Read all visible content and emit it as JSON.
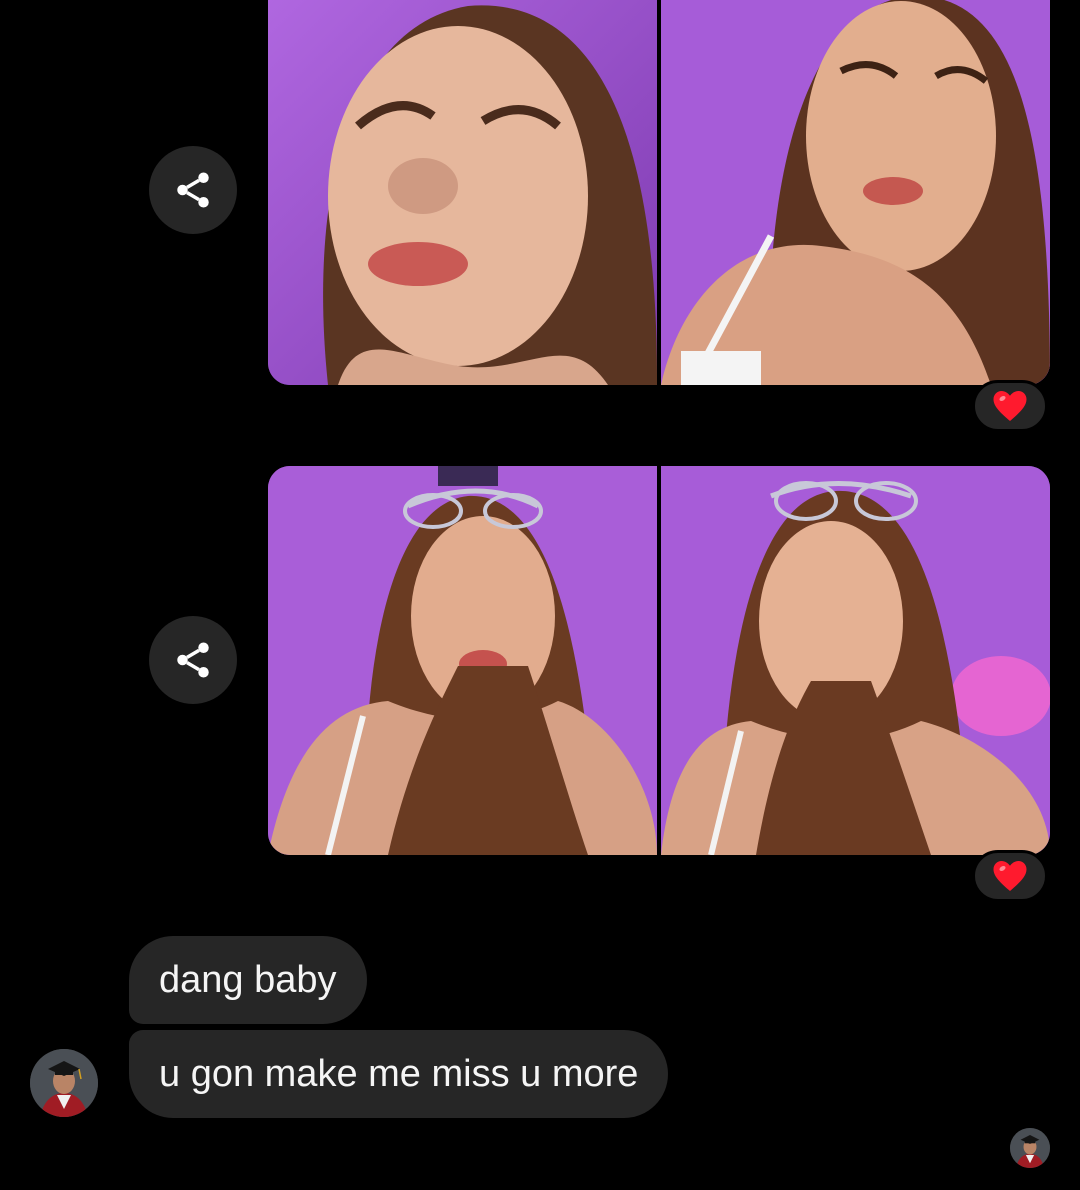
{
  "thread": {
    "photo_groups": [
      {
        "photos": [
          {
            "icon": "selfie-photo-closeup"
          },
          {
            "icon": "selfie-photo-portrait"
          }
        ],
        "share_icon": "share-icon",
        "reaction": "❤️"
      },
      {
        "photos": [
          {
            "icon": "selfie-photo-sunglasses-on-head"
          },
          {
            "icon": "selfie-photo-sunglasses-on-head"
          }
        ],
        "share_icon": "share-icon",
        "reaction": "❤️"
      }
    ],
    "messages": [
      {
        "text": "dang baby"
      },
      {
        "text": "u gon make me miss u more"
      }
    ],
    "sender_avatar": "graduate-avatar",
    "seen_avatar": "graduate-avatar"
  },
  "colors": {
    "background": "#000000",
    "bubble": "#262626",
    "heart": "#ff1a2e",
    "photo_bg": "#a459d6"
  }
}
